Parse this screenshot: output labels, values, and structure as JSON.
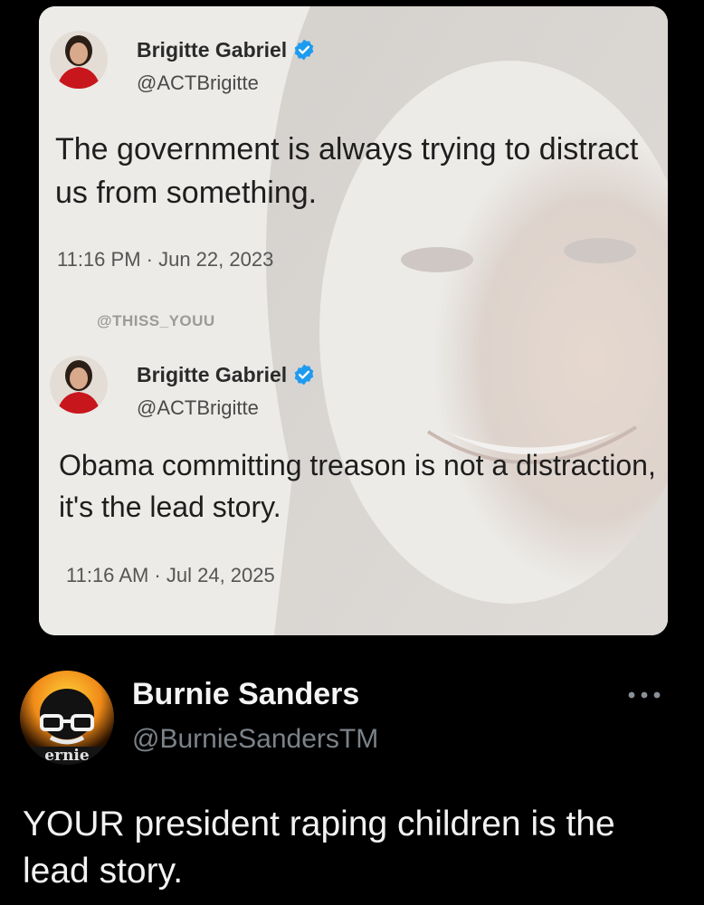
{
  "colors": {
    "background": "#000000",
    "card_background": "#ecebe8",
    "verified_blue": "#1d9bf0",
    "reply_text": "#f2f2f2",
    "reply_handle": "#7b8288"
  },
  "embedded_image": {
    "tweets": [
      {
        "author_name": "Brigitte Gabriel",
        "handle": "@ACTBrigitte",
        "verified_icon": "verified-badge-icon",
        "text": "The government is always trying to distract us from something.",
        "timestamp": "11:16 PM · Jun 22, 2023"
      },
      {
        "author_name": "Brigitte Gabriel",
        "handle": "@ACTBrigitte",
        "verified_icon": "verified-badge-icon",
        "text": "Obama committing treason is not a distraction, it's the lead story.",
        "timestamp": "11:16 AM · Jul 24, 2025"
      }
    ],
    "watermark": "@THISS_YOUU"
  },
  "reply": {
    "author_name": "Burnie Sanders",
    "handle": "@BurnieSandersTM",
    "avatar_text": "ernie",
    "more_icon": "more-options-icon",
    "text": "YOUR president raping children is the lead story."
  }
}
